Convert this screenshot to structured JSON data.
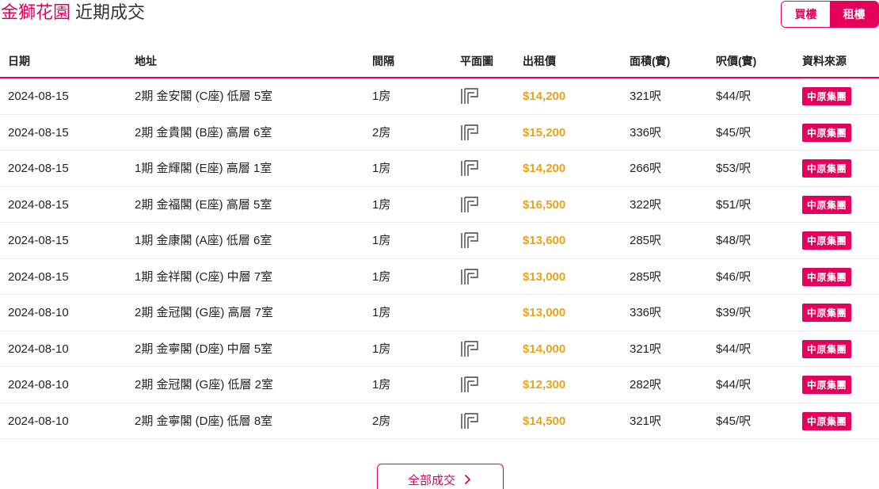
{
  "header": {
    "estate_name": "金獅花園",
    "title_suffix": "近期成交",
    "toggle": {
      "buy": "買樓",
      "rent": "租樓",
      "active": "rent"
    }
  },
  "colors": {
    "accent": "#e5005b",
    "price": "#e8a317"
  },
  "table": {
    "columns": [
      "日期",
      "地址",
      "間隔",
      "平面圖",
      "出租價",
      "面積(實)",
      "呎價(實)",
      "資料來源"
    ],
    "rows": [
      {
        "date": "2024-08-15",
        "address": "2期 金安閣 (C座) 低層 5室",
        "rooms": "1房",
        "floorplan": true,
        "price": "$14,200",
        "area": "321呎",
        "unit_price": "$44/呎",
        "source": "中原集團"
      },
      {
        "date": "2024-08-15",
        "address": "2期 金貴閣 (B座) 高層 6室",
        "rooms": "2房",
        "floorplan": true,
        "price": "$15,200",
        "area": "336呎",
        "unit_price": "$45/呎",
        "source": "中原集團"
      },
      {
        "date": "2024-08-15",
        "address": "1期 金輝閣 (E座) 高層 1室",
        "rooms": "1房",
        "floorplan": true,
        "price": "$14,200",
        "area": "266呎",
        "unit_price": "$53/呎",
        "source": "中原集團"
      },
      {
        "date": "2024-08-15",
        "address": "2期 金福閣 (E座) 高層 5室",
        "rooms": "1房",
        "floorplan": true,
        "price": "$16,500",
        "area": "322呎",
        "unit_price": "$51/呎",
        "source": "中原集團"
      },
      {
        "date": "2024-08-15",
        "address": "1期 金康閣 (A座) 低層 6室",
        "rooms": "1房",
        "floorplan": true,
        "price": "$13,600",
        "area": "285呎",
        "unit_price": "$48/呎",
        "source": "中原集團"
      },
      {
        "date": "2024-08-15",
        "address": "1期 金祥閣 (C座) 中層 7室",
        "rooms": "1房",
        "floorplan": true,
        "price": "$13,000",
        "area": "285呎",
        "unit_price": "$46/呎",
        "source": "中原集團"
      },
      {
        "date": "2024-08-10",
        "address": "2期 金冠閣 (G座) 高層 7室",
        "rooms": "1房",
        "floorplan": false,
        "price": "$13,000",
        "area": "336呎",
        "unit_price": "$39/呎",
        "source": "中原集團"
      },
      {
        "date": "2024-08-10",
        "address": "2期 金寧閣 (D座) 中層 5室",
        "rooms": "1房",
        "floorplan": true,
        "price": "$14,000",
        "area": "321呎",
        "unit_price": "$44/呎",
        "source": "中原集團"
      },
      {
        "date": "2024-08-10",
        "address": "2期 金冠閣 (G座) 低層 2室",
        "rooms": "1房",
        "floorplan": true,
        "price": "$12,300",
        "area": "282呎",
        "unit_price": "$44/呎",
        "source": "中原集團"
      },
      {
        "date": "2024-08-10",
        "address": "2期 金寧閣 (D座) 低層 8室",
        "rooms": "2房",
        "floorplan": true,
        "price": "$14,500",
        "area": "321呎",
        "unit_price": "$45/呎",
        "source": "中原集團"
      }
    ]
  },
  "footer": {
    "all_transactions_label": "全部成交",
    "chevron_icon": "chevron-right-icon"
  }
}
